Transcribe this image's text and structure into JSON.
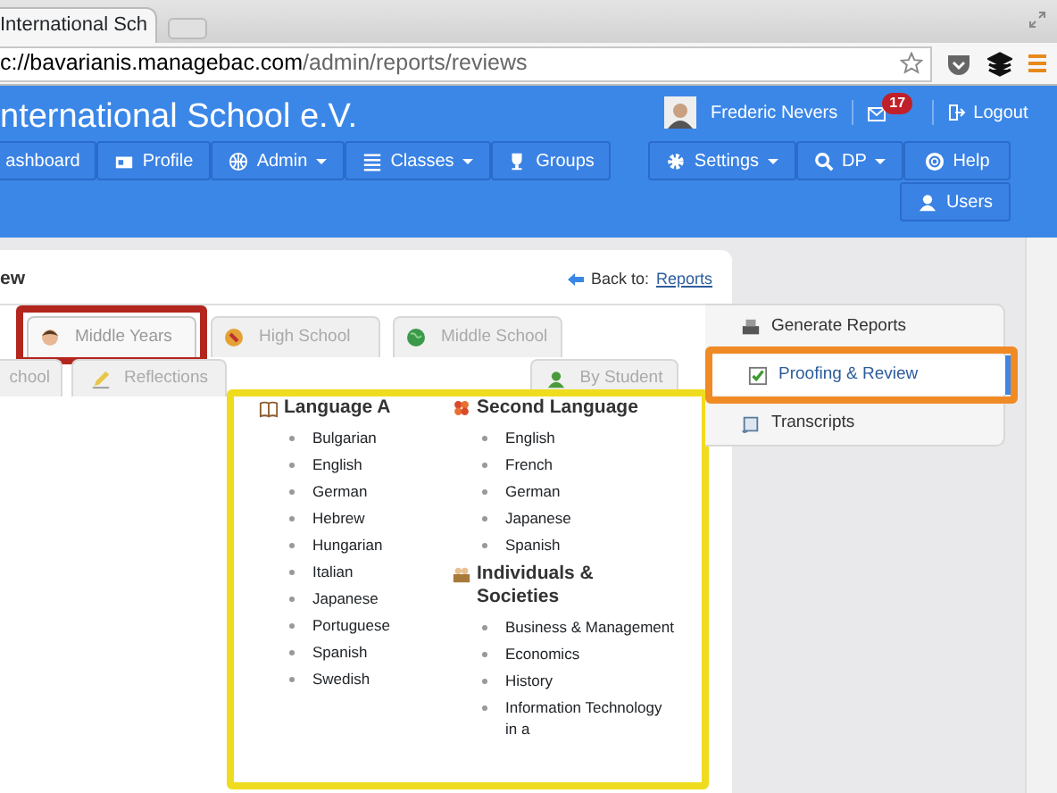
{
  "browser": {
    "tab_title": "International Sch",
    "address_host": "c://bavarianis.managebac.com",
    "address_path": "/admin/reports/reviews"
  },
  "header": {
    "school_name": "nternational School e.V.",
    "user_name": "Frederic Nevers",
    "mail_count": "17",
    "logout": "Logout",
    "nav_left": [
      {
        "label": "ashboard",
        "caret": false
      },
      {
        "label": "Profile",
        "caret": false
      },
      {
        "label": "Admin",
        "caret": true
      },
      {
        "label": "Classes",
        "caret": true
      },
      {
        "label": "Groups",
        "caret": false
      }
    ],
    "nav_right": [
      {
        "label": "Settings",
        "caret": true
      },
      {
        "label": "DP",
        "caret": true
      },
      {
        "label": "Help",
        "caret": false
      },
      {
        "label": "Users",
        "caret": false
      }
    ]
  },
  "page": {
    "heading": "ew",
    "back_label": "Back to:",
    "back_link": "Reports"
  },
  "program_tabs": [
    {
      "label": "Middle Years",
      "selected": true,
      "highlighted": true
    },
    {
      "label": "High School",
      "selected": false,
      "highlighted": false
    },
    {
      "label": "Middle School",
      "selected": false,
      "highlighted": false
    }
  ],
  "sub_tabs": [
    {
      "label": "chool"
    },
    {
      "label": "Reflections"
    },
    {
      "label": "By Student"
    }
  ],
  "subjects_highlighted": true,
  "subject_columns": [
    [
      {
        "heading": "Language A",
        "items": [
          "Bulgarian",
          "English",
          "German",
          "Hebrew",
          "Hungarian",
          "Italian",
          "Japanese",
          "Portuguese",
          "Spanish",
          "Swedish"
        ]
      }
    ],
    [
      {
        "heading": "Second Language",
        "items": [
          "English",
          "French",
          "German",
          "Japanese",
          "Spanish"
        ]
      },
      {
        "heading": "Individuals & Societies",
        "items": [
          "Business & Management",
          "Economics",
          "History",
          "Information Technology in a"
        ]
      }
    ]
  ],
  "sidebar": [
    {
      "label": "Generate Reports",
      "selected": false,
      "highlighted": false
    },
    {
      "label": "Proofing & Review",
      "selected": true,
      "highlighted": true
    },
    {
      "label": "Transcripts",
      "selected": false,
      "highlighted": false
    }
  ]
}
